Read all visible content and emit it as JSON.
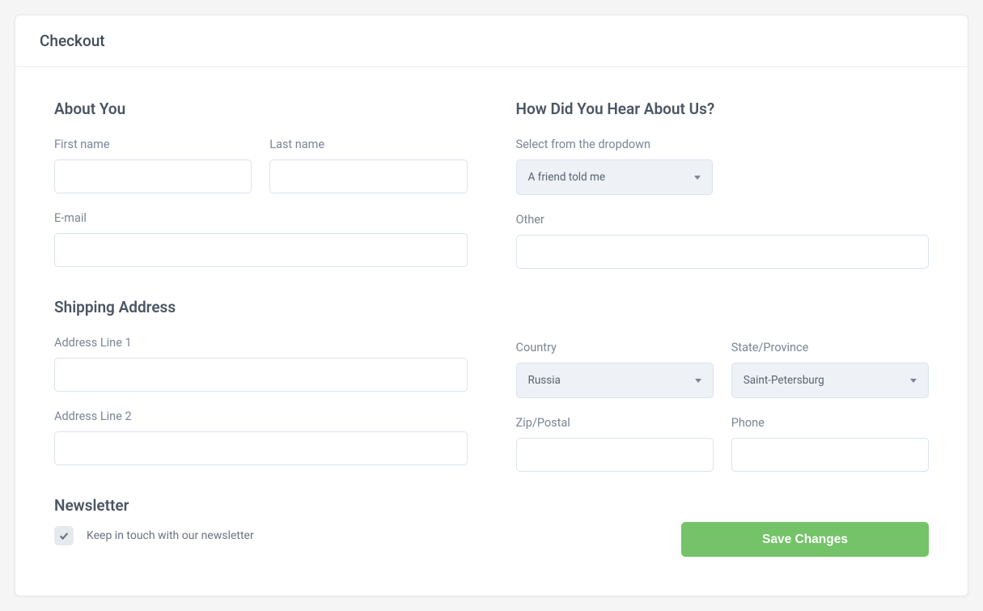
{
  "header": {
    "title": "Checkout"
  },
  "about": {
    "heading": "About You",
    "first_name_label": "First name",
    "last_name_label": "Last name",
    "email_label": "E-mail",
    "first_name_value": "",
    "last_name_value": "",
    "email_value": ""
  },
  "hear": {
    "heading": "How Did You Hear About Us?",
    "select_label": "Select from the dropdown",
    "select_value": "A friend told me",
    "other_label": "Other",
    "other_value": ""
  },
  "shipping": {
    "heading": "Shipping Address",
    "addr1_label": "Address Line 1",
    "addr2_label": "Address Line 2",
    "country_label": "Country",
    "state_label": "State/Province",
    "zip_label": "Zip/Postal",
    "phone_label": "Phone",
    "addr1_value": "",
    "addr2_value": "",
    "country_value": "Russia",
    "state_value": "Saint-Petersburg",
    "zip_value": "",
    "phone_value": ""
  },
  "newsletter": {
    "heading": "Newsletter",
    "checkbox_label": "Keep in touch with our newsletter",
    "checked": true
  },
  "actions": {
    "save_label": "Save Changes"
  }
}
